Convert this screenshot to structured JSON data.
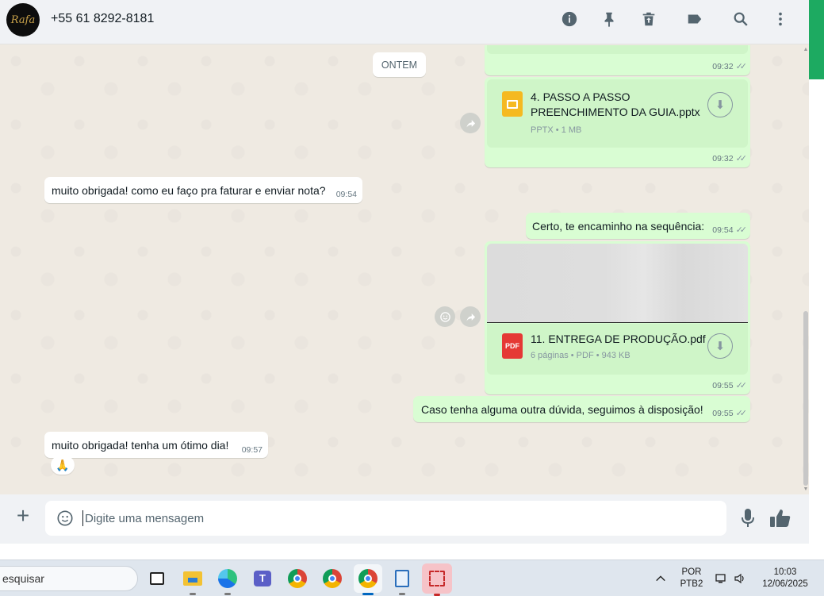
{
  "header": {
    "avatar_text": "Rafa",
    "contact_name": "+55 61 8292-8181",
    "icons": [
      "info-icon",
      "pin-icon",
      "delete-icon",
      "label-icon",
      "search-icon",
      "menu-icon"
    ]
  },
  "chat": {
    "date_chip": "ONTEM",
    "top_partial_time": "09:32",
    "doc1": {
      "title_line1": "4. PASSO A PASSO",
      "title_line2": "PREENCHIMENTO DA GUIA.pptx",
      "subtitle": "PPTX • 1 MB",
      "time": "09:32"
    },
    "in_msg1": {
      "text": "muito obrigada! como eu faço pra faturar e enviar nota?",
      "time": "09:54"
    },
    "out_msg1": {
      "text": "Certo, te encaminho na sequência:",
      "time": "09:54"
    },
    "doc2": {
      "title": "11. ENTREGA DE PRODUÇÃO.pdf",
      "subtitle": "6 páginas • PDF • 943 KB",
      "badge": "PDF",
      "time": "09:55"
    },
    "out_msg2": {
      "text": "Caso tenha alguma outra dúvida, seguimos à disposição!",
      "time": "09:55"
    },
    "in_msg2": {
      "text": "muito obrigada! tenha um ótimo dia!",
      "time": "09:57",
      "reaction": "🙏"
    },
    "ticks": "✓✓"
  },
  "composer": {
    "placeholder": "Digite uma mensagem"
  },
  "taskbar": {
    "search_text": "esquisar",
    "lang_line1": "POR",
    "lang_line2": "PTB2",
    "time": "10:03",
    "date": "12/06/2025"
  }
}
